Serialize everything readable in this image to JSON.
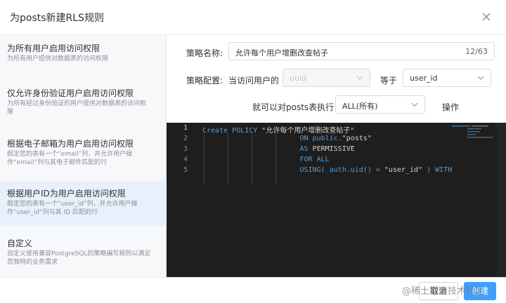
{
  "dialog": {
    "title": "为posts新建RLS规则"
  },
  "sidebar": {
    "options": [
      {
        "title": "为所有用户启用访问权限",
        "desc_lines": [
          "为所有用户提供对数据表的访问权限"
        ]
      },
      {
        "title": "仅允许身份验证用户启用访问权限",
        "desc_lines": [
          "为所有经过身份验证的用户提供对数据表的访问权",
          "限"
        ]
      },
      {
        "title": "根据电子邮箱为用户启用访问权限",
        "desc_lines": [
          "假定您的表有一个“email”列，并允许用户操",
          "作“email”列与其电子邮件匹配的行"
        ]
      },
      {
        "title": "根据用户ID为用户启用访问权限",
        "desc_lines": [
          "假定您的表有一个“user_id”列，并允许用户操",
          "作“user_id”列与其 ID 匹配的行"
        ]
      },
      {
        "title": "自定义",
        "desc_lines": [
          "自定义使用兼容PostgreSQL的策略编写规则以满足",
          "您独特的业务需求"
        ]
      }
    ],
    "selected_index": 3
  },
  "form": {
    "name_label": "策略名称:",
    "name_value": "允许每个用户增删改查帖子",
    "name_count": "12/63",
    "config_label": "策略配置:",
    "config_prefix": "当访问用户的",
    "config_field_value": "uuid",
    "config_equals": "等于",
    "config_target_value": "user_id",
    "apply_label": "就可以对posts表执行",
    "apply_value": "ALL(所有)",
    "action_label": "操作"
  },
  "editor": {
    "line_numbers": [
      "1",
      "2",
      "3",
      "4",
      "5"
    ],
    "lines": [
      [
        {
          "t": "Create POLICY ",
          "c": "kw"
        },
        {
          "t": "\"允许每个用户增删改查帖子\"",
          "c": "pl"
        }
      ],
      [
        {
          "t": "                       ",
          "c": "pl"
        },
        {
          "t": "ON public.",
          "c": "kw"
        },
        {
          "t": "\"posts\"",
          "c": "pl"
        }
      ],
      [
        {
          "t": "                       ",
          "c": "pl"
        },
        {
          "t": "AS ",
          "c": "kw"
        },
        {
          "t": "PERMISSIVE",
          "c": "pl"
        }
      ],
      [
        {
          "t": "                       ",
          "c": "pl"
        },
        {
          "t": "FOR ALL",
          "c": "kw"
        }
      ],
      [
        {
          "t": "                       ",
          "c": "pl"
        },
        {
          "t": "USING( auth.uid() = ",
          "c": "kw"
        },
        {
          "t": "\"user_id\"",
          "c": "pl"
        },
        {
          "t": " ) WITH",
          "c": "kw"
        }
      ]
    ]
  },
  "footer": {
    "cancel_label": "取消",
    "create_label": "创建"
  },
  "watermark": "@稀土掘金技术社区",
  "icons": {
    "close": "close-icon",
    "chevron": "chevron-down-icon"
  },
  "colors": {
    "primary": "#409eff",
    "selected_bg": "#e8f0fb",
    "editor_bg": "#1e1e1e",
    "keyword": "#569cd6",
    "text": "#d4d4d4"
  }
}
